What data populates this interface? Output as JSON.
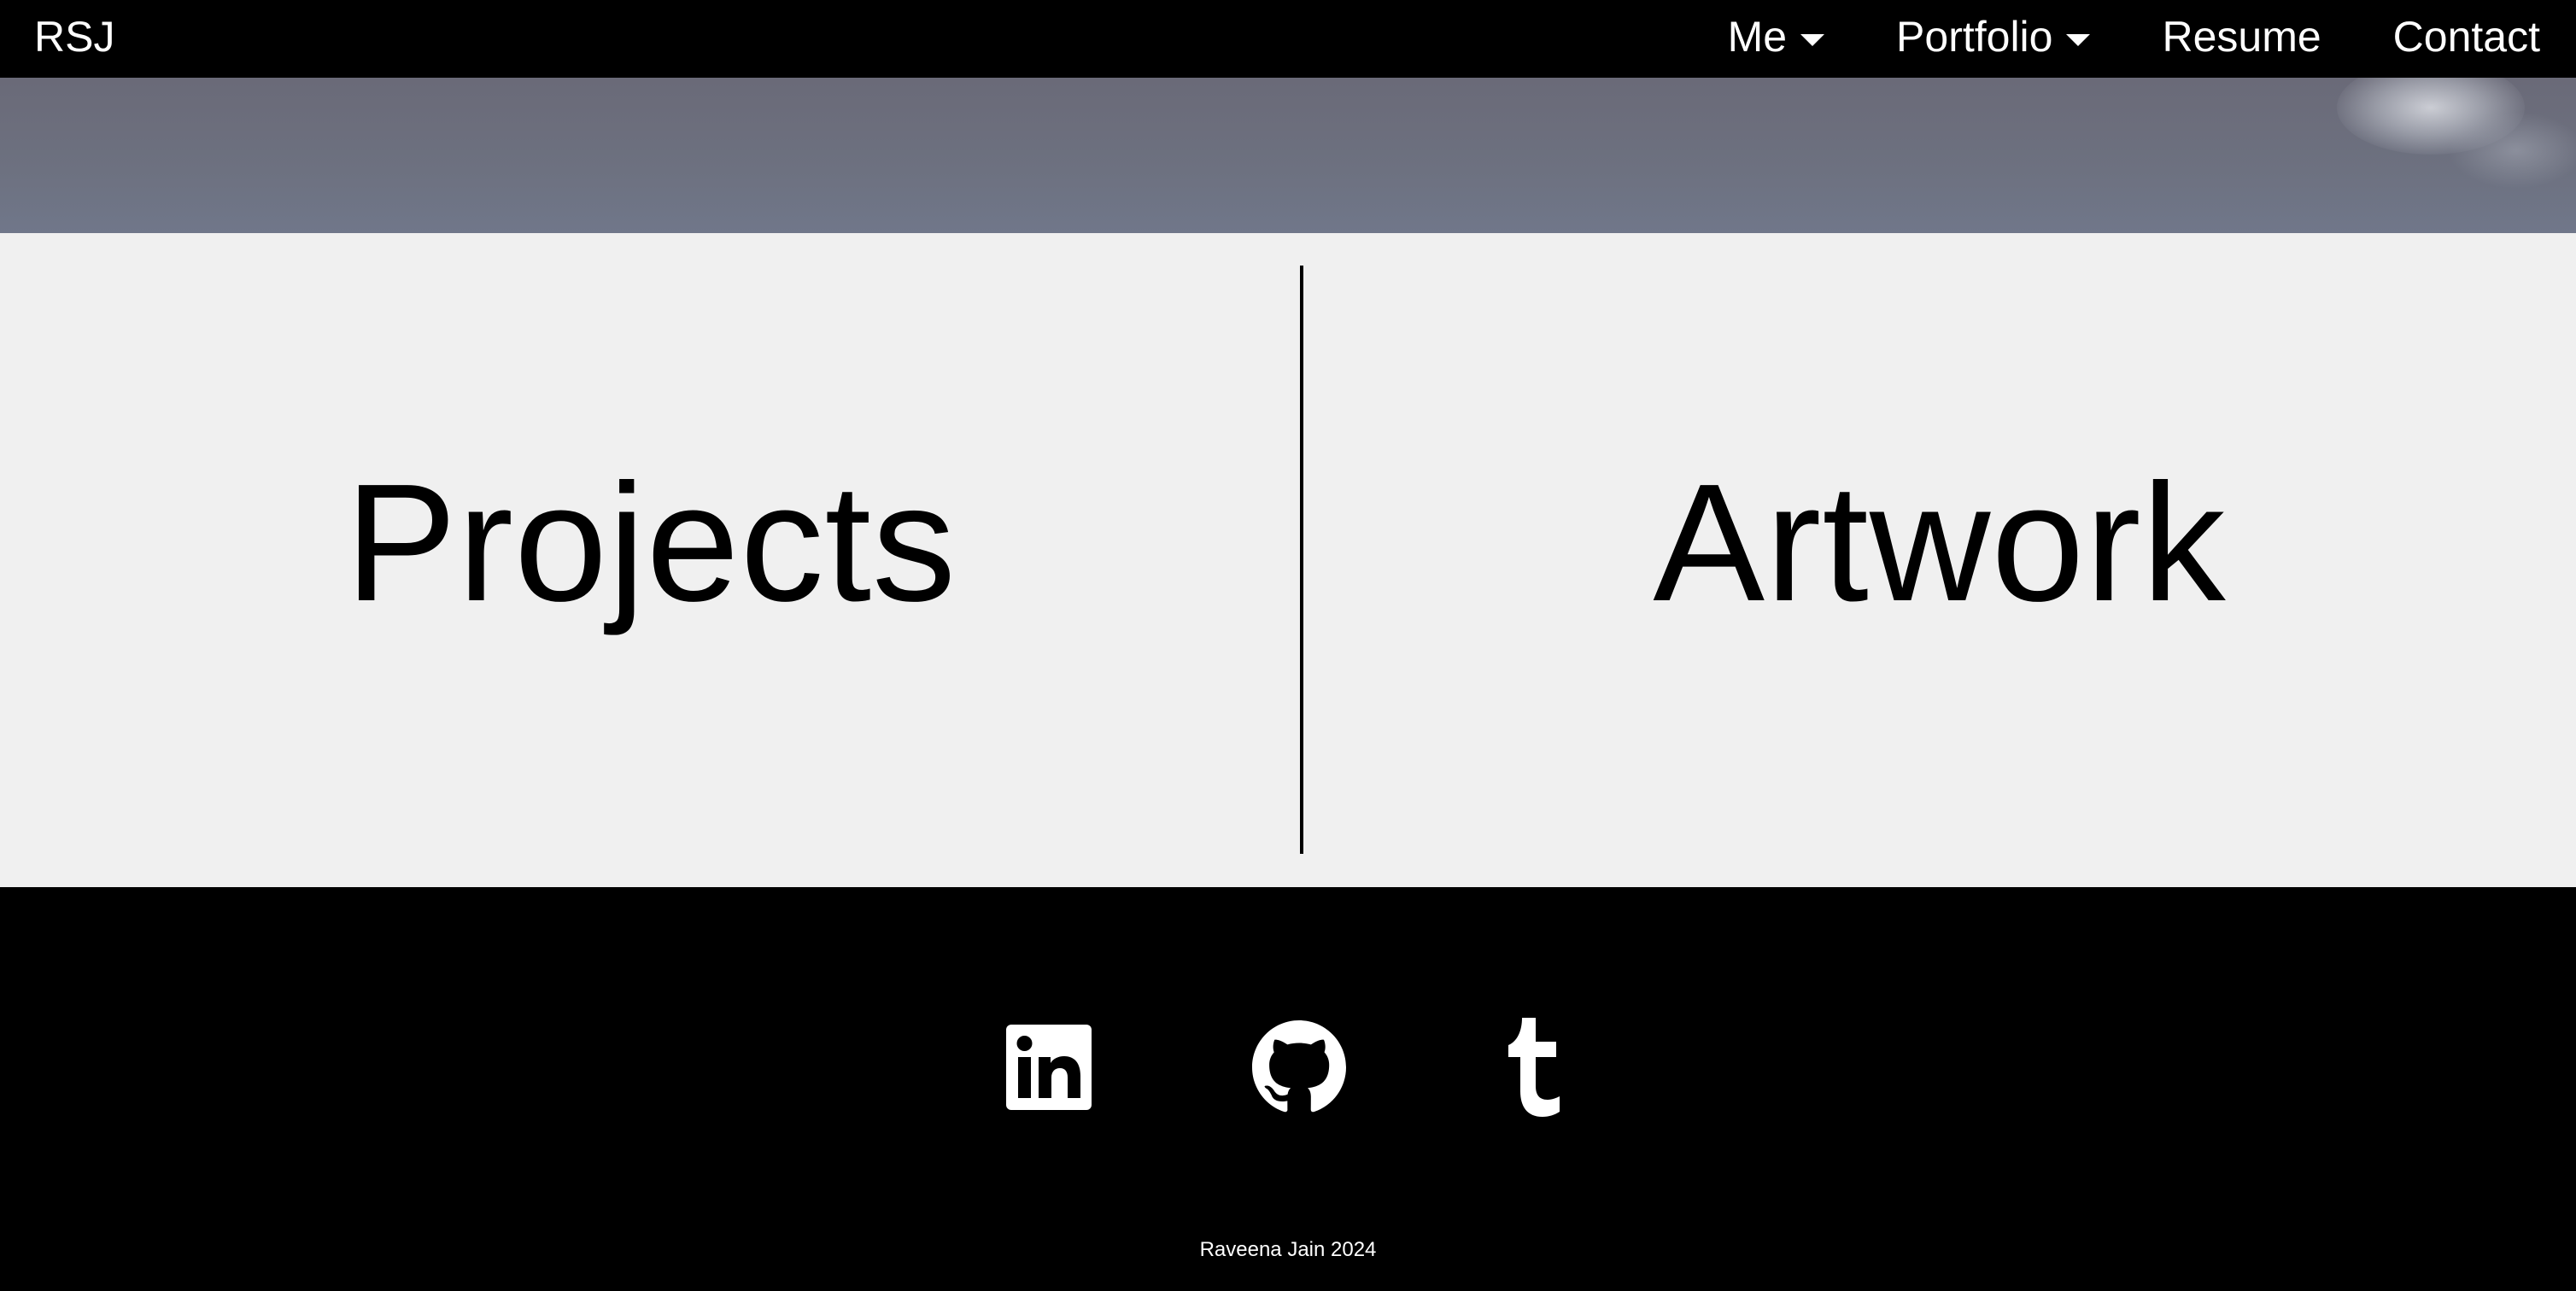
{
  "navbar": {
    "brand": "RSJ",
    "items": [
      {
        "label": "Me",
        "has_dropdown": true
      },
      {
        "label": "Portfolio",
        "has_dropdown": true
      },
      {
        "label": "Resume",
        "has_dropdown": false
      },
      {
        "label": "Contact",
        "has_dropdown": false
      }
    ]
  },
  "split": {
    "left_label": "Projects",
    "right_label": "Artwork"
  },
  "footer": {
    "social": [
      {
        "name": "linkedin-icon"
      },
      {
        "name": "github-icon"
      },
      {
        "name": "tumblr-icon"
      }
    ],
    "copyright": "Raveena Jain 2024"
  },
  "colors": {
    "nav_bg": "#000000",
    "split_bg": "#f0f0f0",
    "text_dark": "#000000",
    "text_light": "#ffffff"
  }
}
